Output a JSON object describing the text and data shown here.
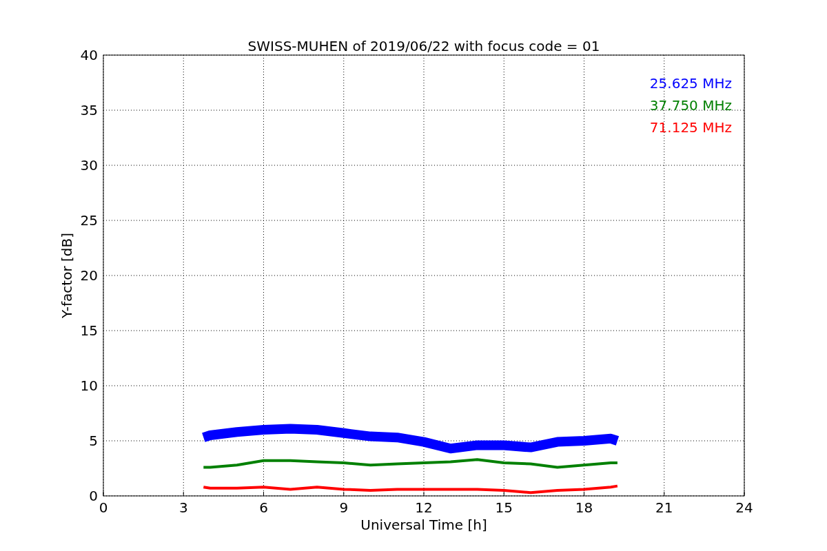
{
  "chart_data": {
    "type": "line",
    "title": "SWISS-MUHEN of 2019/06/22 with focus code = 01",
    "xlabel": "Universal Time [h]",
    "ylabel": "Y-factor [dB]",
    "x": [
      3.75,
      4,
      5,
      6,
      7,
      8,
      9,
      10,
      11,
      12,
      13,
      14,
      15,
      16,
      17,
      18,
      19,
      19.25
    ],
    "series": [
      {
        "name": "25.625 MHz",
        "color": "#0000ff",
        "values": [
          5.3,
          5.5,
          5.8,
          6.0,
          6.1,
          6.0,
          5.7,
          5.4,
          5.3,
          4.9,
          4.3,
          4.6,
          4.6,
          4.4,
          4.9,
          5.0,
          5.2,
          5.0
        ]
      },
      {
        "name": "37.750 MHz",
        "color": "#008000",
        "values": [
          2.6,
          2.6,
          2.8,
          3.2,
          3.2,
          3.1,
          3.0,
          2.8,
          2.9,
          3.0,
          3.1,
          3.3,
          3.0,
          2.9,
          2.6,
          2.8,
          3.0,
          3.0
        ]
      },
      {
        "name": "71.125 MHz",
        "color": "#ff0000",
        "values": [
          0.8,
          0.7,
          0.7,
          0.8,
          0.6,
          0.8,
          0.6,
          0.5,
          0.6,
          0.6,
          0.6,
          0.6,
          0.5,
          0.3,
          0.5,
          0.6,
          0.8,
          0.9
        ]
      }
    ],
    "grid": true,
    "xlim": [
      0,
      24
    ],
    "ylim": [
      0,
      40
    ],
    "xticks": [
      0,
      3,
      6,
      9,
      12,
      15,
      18,
      21,
      24
    ],
    "yticks": [
      0,
      5,
      10,
      15,
      20,
      25,
      30,
      35,
      40
    ]
  }
}
